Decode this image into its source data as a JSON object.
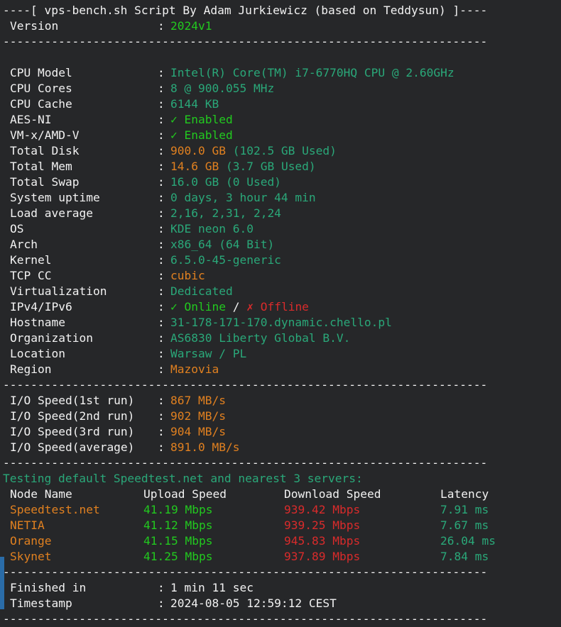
{
  "theme": {
    "background": "#262729",
    "foreground": "#f2f2f2",
    "teal": "#2aa879",
    "green": "#22c91f",
    "orange": "#e08020",
    "red": "#d92b2b",
    "scrollbar": "#2a6ca8"
  },
  "header": {
    "banner": "----[ vps-bench.sh Script By Adam Jurkiewicz (based on Teddysun) ]----",
    "version_label": "Version",
    "version_value": "2024v1",
    "colon": ":"
  },
  "separator": "----------------------------------------------------------------------",
  "system": {
    "rows": [
      {
        "label": "CPU Model",
        "value": "Intel(R) Core(TM) i7-6770HQ CPU @ 2.60GHz",
        "color": "teal"
      },
      {
        "label": "CPU Cores",
        "value": "8 @ 900.055 MHz",
        "color": "teal"
      },
      {
        "label": "CPU Cache",
        "value": "6144 KB",
        "color": "teal"
      },
      {
        "label": "AES-NI",
        "value": "✓ Enabled",
        "color": "green"
      },
      {
        "label": "VM-x/AMD-V",
        "value": "✓ Enabled",
        "color": "green"
      },
      {
        "label": "Total Disk",
        "value": "900.0 GB",
        "value2": " (102.5 GB Used)",
        "color": "orange",
        "color2": "teal"
      },
      {
        "label": "Total Mem",
        "value": "14.6 GB",
        "value2": " (3.7 GB Used)",
        "color": "orange",
        "color2": "teal"
      },
      {
        "label": "Total Swap",
        "value": "16.0 GB (0 Used)",
        "color": "teal"
      },
      {
        "label": "System uptime",
        "value": "0 days, 3 hour 44 min",
        "color": "teal"
      },
      {
        "label": "Load average",
        "value": "2,16, 2,31, 2,24",
        "color": "teal"
      },
      {
        "label": "OS",
        "value": "KDE neon 6.0",
        "color": "teal"
      },
      {
        "label": "Arch",
        "value": "x86_64 (64 Bit)",
        "color": "teal"
      },
      {
        "label": "Kernel",
        "value": "6.5.0-45-generic",
        "color": "teal"
      },
      {
        "label": "TCP CC",
        "value": "cubic",
        "color": "orange"
      },
      {
        "label": "Virtualization",
        "value": "Dedicated",
        "color": "teal"
      },
      {
        "label": "IPv4/IPv6",
        "value": "✓ Online",
        "color": "green",
        "value2": " / ",
        "color2": "white",
        "value3": "✗ Offline",
        "color3": "red"
      },
      {
        "label": "Hostname",
        "value": "31-178-171-170.dynamic.chello.pl",
        "color": "teal"
      },
      {
        "label": "Organization",
        "value": "AS6830 Liberty Global B.V.",
        "color": "teal"
      },
      {
        "label": "Location",
        "value": "Warsaw / PL",
        "color": "teal"
      },
      {
        "label": "Region",
        "value": "Mazovia",
        "color": "orange"
      }
    ]
  },
  "io": {
    "rows": [
      {
        "label": "I/O Speed(1st run)",
        "value": "867 MB/s",
        "color": "orange"
      },
      {
        "label": "I/O Speed(2nd run)",
        "value": "902 MB/s",
        "color": "orange"
      },
      {
        "label": "I/O Speed(3rd run)",
        "value": "904 MB/s",
        "color": "orange"
      },
      {
        "label": "I/O Speed(average)",
        "value": "891.0 MB/s",
        "color": "orange"
      }
    ]
  },
  "speedtest": {
    "title": "Testing default Speedtest.net and nearest 3 servers:",
    "columns": [
      "Node Name",
      "Upload Speed",
      "Download Speed",
      "Latency"
    ],
    "rows": [
      {
        "node": "Speedtest.net",
        "upload": "41.19 Mbps",
        "download": "939.42 Mbps",
        "latency": "7.91 ms"
      },
      {
        "node": "NETIA",
        "upload": "41.12 Mbps",
        "download": "939.25 Mbps",
        "latency": "7.67 ms"
      },
      {
        "node": "Orange",
        "upload": "41.15 Mbps",
        "download": "945.83 Mbps",
        "latency": "26.04 ms"
      },
      {
        "node": "Skynet",
        "upload": "41.25 Mbps",
        "download": "937.89 Mbps",
        "latency": "7.84 ms"
      }
    ]
  },
  "footer": {
    "rows": [
      {
        "label": "Finished in",
        "value": "1 min 11 sec",
        "color": "white"
      },
      {
        "label": "Timestamp",
        "value": "2024-08-05 12:59:12 CEST",
        "color": "white"
      }
    ]
  }
}
